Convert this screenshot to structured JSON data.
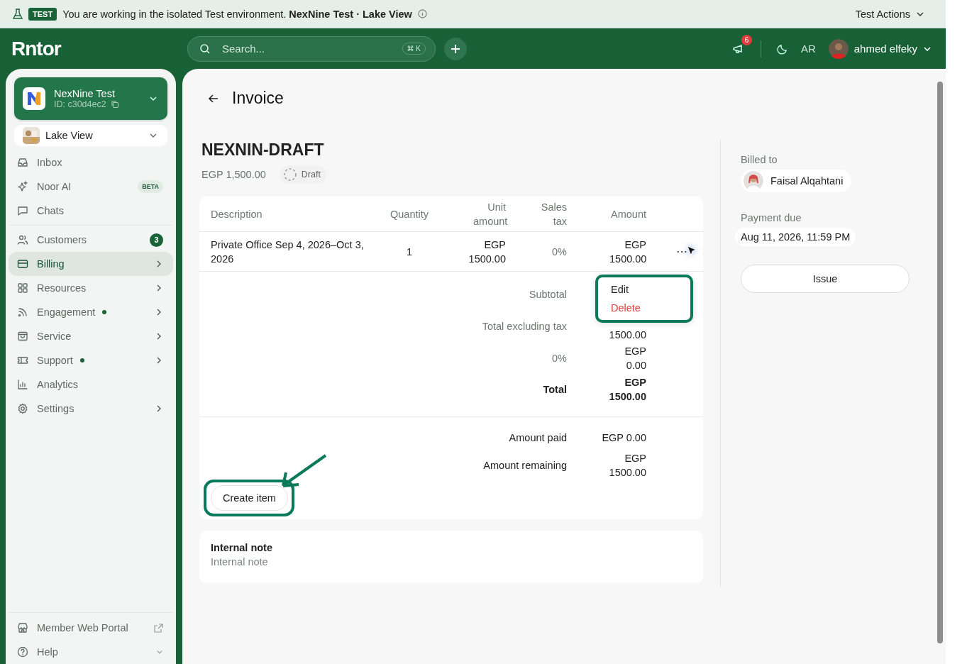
{
  "banner": {
    "badge": "TEST",
    "message": "You are working in the isolated Test environment. **NexNine Test · Lake View**",
    "actions": "Test Actions"
  },
  "header": {
    "logo": "Rntor",
    "search_placeholder": "Search...",
    "shortcut": "⌘ K",
    "notification_count": "6",
    "language": "AR",
    "user": "ahmed elfeky"
  },
  "sidebar": {
    "org": {
      "name": "NexNine Test",
      "id": "ID: c30d4ec2"
    },
    "location": "Lake View",
    "groups": [
      [
        {
          "label": "Inbox",
          "selected": false,
          "submenu": false,
          "dot": false
        },
        {
          "label": "Noor AI",
          "selected": false,
          "submenu": false,
          "dot": false,
          "badge": {
            "text": "BETA",
            "kind": "beta"
          }
        },
        {
          "label": "Chats",
          "selected": false,
          "submenu": false,
          "dot": false
        }
      ],
      [
        {
          "label": "Customers",
          "selected": false,
          "submenu": false,
          "dot": false,
          "badge": {
            "text": "3",
            "kind": "count"
          }
        },
        {
          "label": "Billing",
          "selected": true,
          "submenu": true,
          "dot": false
        },
        {
          "label": "Resources",
          "selected": false,
          "submenu": true,
          "dot": false
        },
        {
          "label": "Engagement",
          "selected": false,
          "submenu": true,
          "dot": true
        },
        {
          "label": "Service",
          "selected": false,
          "submenu": true,
          "dot": false
        },
        {
          "label": "Support",
          "selected": false,
          "submenu": true,
          "dot": true
        },
        {
          "label": "Analytics",
          "selected": false,
          "submenu": false,
          "dot": false
        },
        {
          "label": "Settings",
          "selected": false,
          "submenu": true,
          "dot": false
        }
      ]
    ],
    "footer": [
      {
        "label": "Member Web Portal",
        "kind": "external"
      },
      {
        "label": "Help",
        "kind": "expandable"
      }
    ]
  },
  "page": {
    "title": "Invoice"
  },
  "invoice": {
    "number": "NEXNIN-DRAFT",
    "total": "EGP 1,500.00",
    "status": "Draft",
    "columns": [
      "Description",
      "Quantity",
      "Unit amount",
      "Sales tax",
      "Amount"
    ],
    "rows": [
      {
        "description": "Private Office Sep 4, 2026–Oct 3, 2026",
        "quantity": "1",
        "unit_amount": "EGP 1500.00",
        "sales_tax": "0%",
        "amount": "EGP 1500.00",
        "menu_button": "⋯"
      }
    ],
    "summary": [
      {
        "label": "Subtotal",
        "emphasis": false
      },
      {
        "label": "Total excluding tax",
        "value": "1500.00",
        "emphasis": false
      },
      {
        "label": "0%",
        "value": "EGP 0.00",
        "emphasis": false
      },
      {
        "label": "Total",
        "value": "EGP 1500.00",
        "emphasis": true
      }
    ],
    "payments": [
      {
        "label": "Amount paid",
        "value": "EGP 0.00"
      },
      {
        "label": "Amount remaining",
        "value": "EGP 1500.00"
      }
    ],
    "create_button": "Create item",
    "row_menu": [
      {
        "label": "Edit",
        "kind": "normal"
      },
      {
        "label": "Delete",
        "kind": "danger"
      }
    ],
    "note": {
      "title": "Internal note",
      "placeholder": "Internal note"
    }
  },
  "details": {
    "billed_to_label": "Billed to",
    "customer": "Faisal Alqahtani",
    "payment_due_label": "Payment due",
    "payment_due": "Aug 11, 2026, 11:59 PM",
    "issue_button": "Issue"
  }
}
